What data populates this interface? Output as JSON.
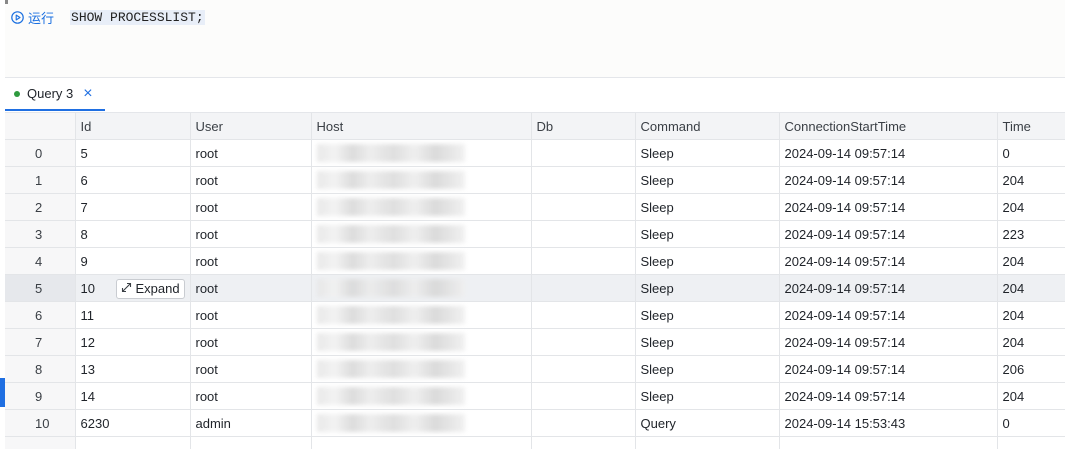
{
  "editor": {
    "run_label": "运行",
    "sql": "SHOW PROCESSLIST;"
  },
  "tabs": [
    {
      "label": "Query 3",
      "active": true,
      "status_color": "#2e9a3e"
    }
  ],
  "grid": {
    "columns": [
      "",
      "Id",
      "User",
      "Host",
      "Db",
      "Command",
      "ConnectionStartTime",
      "Time"
    ],
    "expand_label": "Expand",
    "rows": [
      {
        "index": "0",
        "id": "5",
        "user": "root",
        "db": "",
        "command": "Sleep",
        "start": "2024-09-14 09:57:14",
        "time": "0"
      },
      {
        "index": "1",
        "id": "6",
        "user": "root",
        "db": "",
        "command": "Sleep",
        "start": "2024-09-14 09:57:14",
        "time": "204"
      },
      {
        "index": "2",
        "id": "7",
        "user": "root",
        "db": "",
        "command": "Sleep",
        "start": "2024-09-14 09:57:14",
        "time": "204"
      },
      {
        "index": "3",
        "id": "8",
        "user": "root",
        "db": "",
        "command": "Sleep",
        "start": "2024-09-14 09:57:14",
        "time": "223"
      },
      {
        "index": "4",
        "id": "9",
        "user": "root",
        "db": "",
        "command": "Sleep",
        "start": "2024-09-14 09:57:14",
        "time": "204"
      },
      {
        "index": "5",
        "id": "10",
        "user": "root",
        "db": "",
        "command": "Sleep",
        "start": "2024-09-14 09:57:14",
        "time": "204"
      },
      {
        "index": "6",
        "id": "11",
        "user": "root",
        "db": "",
        "command": "Sleep",
        "start": "2024-09-14 09:57:14",
        "time": "204"
      },
      {
        "index": "7",
        "id": "12",
        "user": "root",
        "db": "",
        "command": "Sleep",
        "start": "2024-09-14 09:57:14",
        "time": "204"
      },
      {
        "index": "8",
        "id": "13",
        "user": "root",
        "db": "",
        "command": "Sleep",
        "start": "2024-09-14 09:57:14",
        "time": "206"
      },
      {
        "index": "9",
        "id": "14",
        "user": "root",
        "db": "",
        "command": "Sleep",
        "start": "2024-09-14 09:57:14",
        "time": "204"
      },
      {
        "index": "10",
        "id": "6230",
        "user": "admin",
        "db": "",
        "command": "Query",
        "start": "2024-09-14 15:53:43",
        "time": "0"
      }
    ]
  },
  "colors": {
    "accent": "#1f6fe2",
    "tab_status": "#2e9a3e"
  }
}
